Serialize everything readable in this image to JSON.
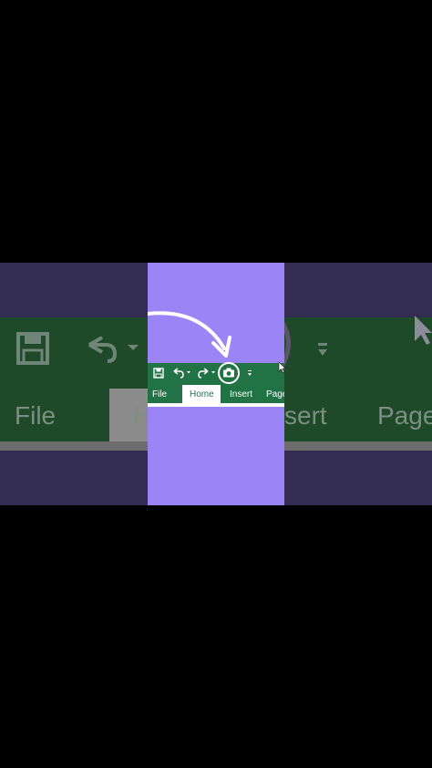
{
  "ribbon": {
    "tabs": [
      "File",
      "Home",
      "Insert",
      "Page"
    ]
  },
  "background": {
    "tabs": [
      "File",
      "H",
      "sert",
      "Page"
    ]
  },
  "colors": {
    "excel_green": "#217346",
    "frame_purple": "#9b84f6",
    "dim_band": "#342d52",
    "backdrop": "#000000"
  },
  "icons": [
    "save-icon",
    "undo-icon",
    "redo-icon",
    "camera-icon",
    "customize-icon",
    "cursor-icon",
    "arrow-annotation"
  ]
}
